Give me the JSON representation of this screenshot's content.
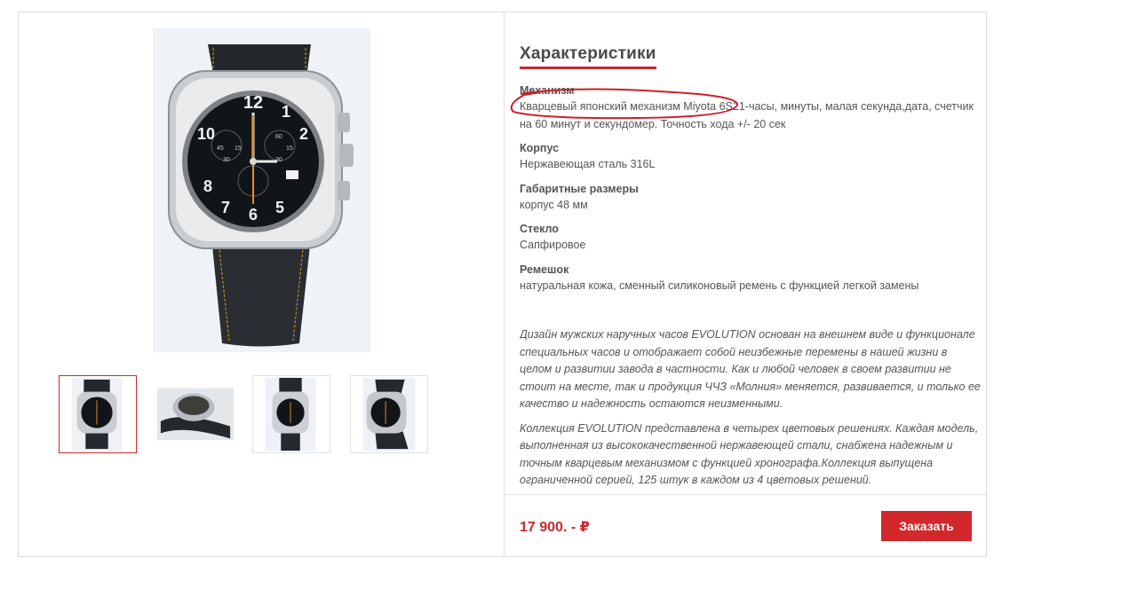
{
  "product": {
    "price": "17 900. - ₽",
    "order_button": "Заказать"
  },
  "gallery": {
    "thumbnails": [
      {
        "view": "front",
        "active": true
      },
      {
        "view": "side",
        "active": false
      },
      {
        "view": "front-small",
        "active": false
      },
      {
        "view": "angled",
        "active": false
      }
    ]
  },
  "specs": {
    "title": "Характеристики",
    "items": [
      {
        "label": "Механизм",
        "value": "Кварцевый японский механизм Miyota 6S21-часы, минуты, малая секунда,дата, счетчик на 60 минут и секундомер. Точность хода +/- 20 сек"
      },
      {
        "label": "Корпус",
        "value": "Нержавеющая сталь 316L"
      },
      {
        "label": "Габаритные размеры",
        "value": "корпус 48 мм"
      },
      {
        "label": "Стекло",
        "value": "Сапфировое"
      },
      {
        "label": "Ремешок",
        "value": "натуральная кожа, сменный силиконовый ремень с функцией легкой замены"
      }
    ],
    "description": [
      "Дизайн мужских наручных часов EVOLUTION основан на внешнем виде и функционале специальных часов и отображает собой  неизбежные перемены в нашей жизни в целом и развитии завода в частности. Как и любой человек в своем развитии не стоит на месте, так и продукция ЧЧЗ «Молния» меняется, развивается, и только ее качество и надежность остаются неизменными.",
      "Коллекция EVOLUTION представлена в четырех цветовых решениях. Каждая модель, выполненная из высококачественной нержавеющей стали, снабжена надежным и точным кварцевым механизмом с функцией хронографа.Коллекция выпущена ограниченной серией, 125 штук в каждом из 4 цветовых решений."
    ]
  },
  "watch_dial": {
    "numerals": [
      "12",
      "1",
      "2",
      "10",
      "8",
      "7",
      "6",
      "5"
    ],
    "sub_dials": [
      "45",
      "15",
      "30",
      "60",
      "15",
      "30"
    ]
  },
  "colors": {
    "accent": "#c8282c",
    "button": "#d2282c",
    "annotation": "#cc1f2a"
  }
}
